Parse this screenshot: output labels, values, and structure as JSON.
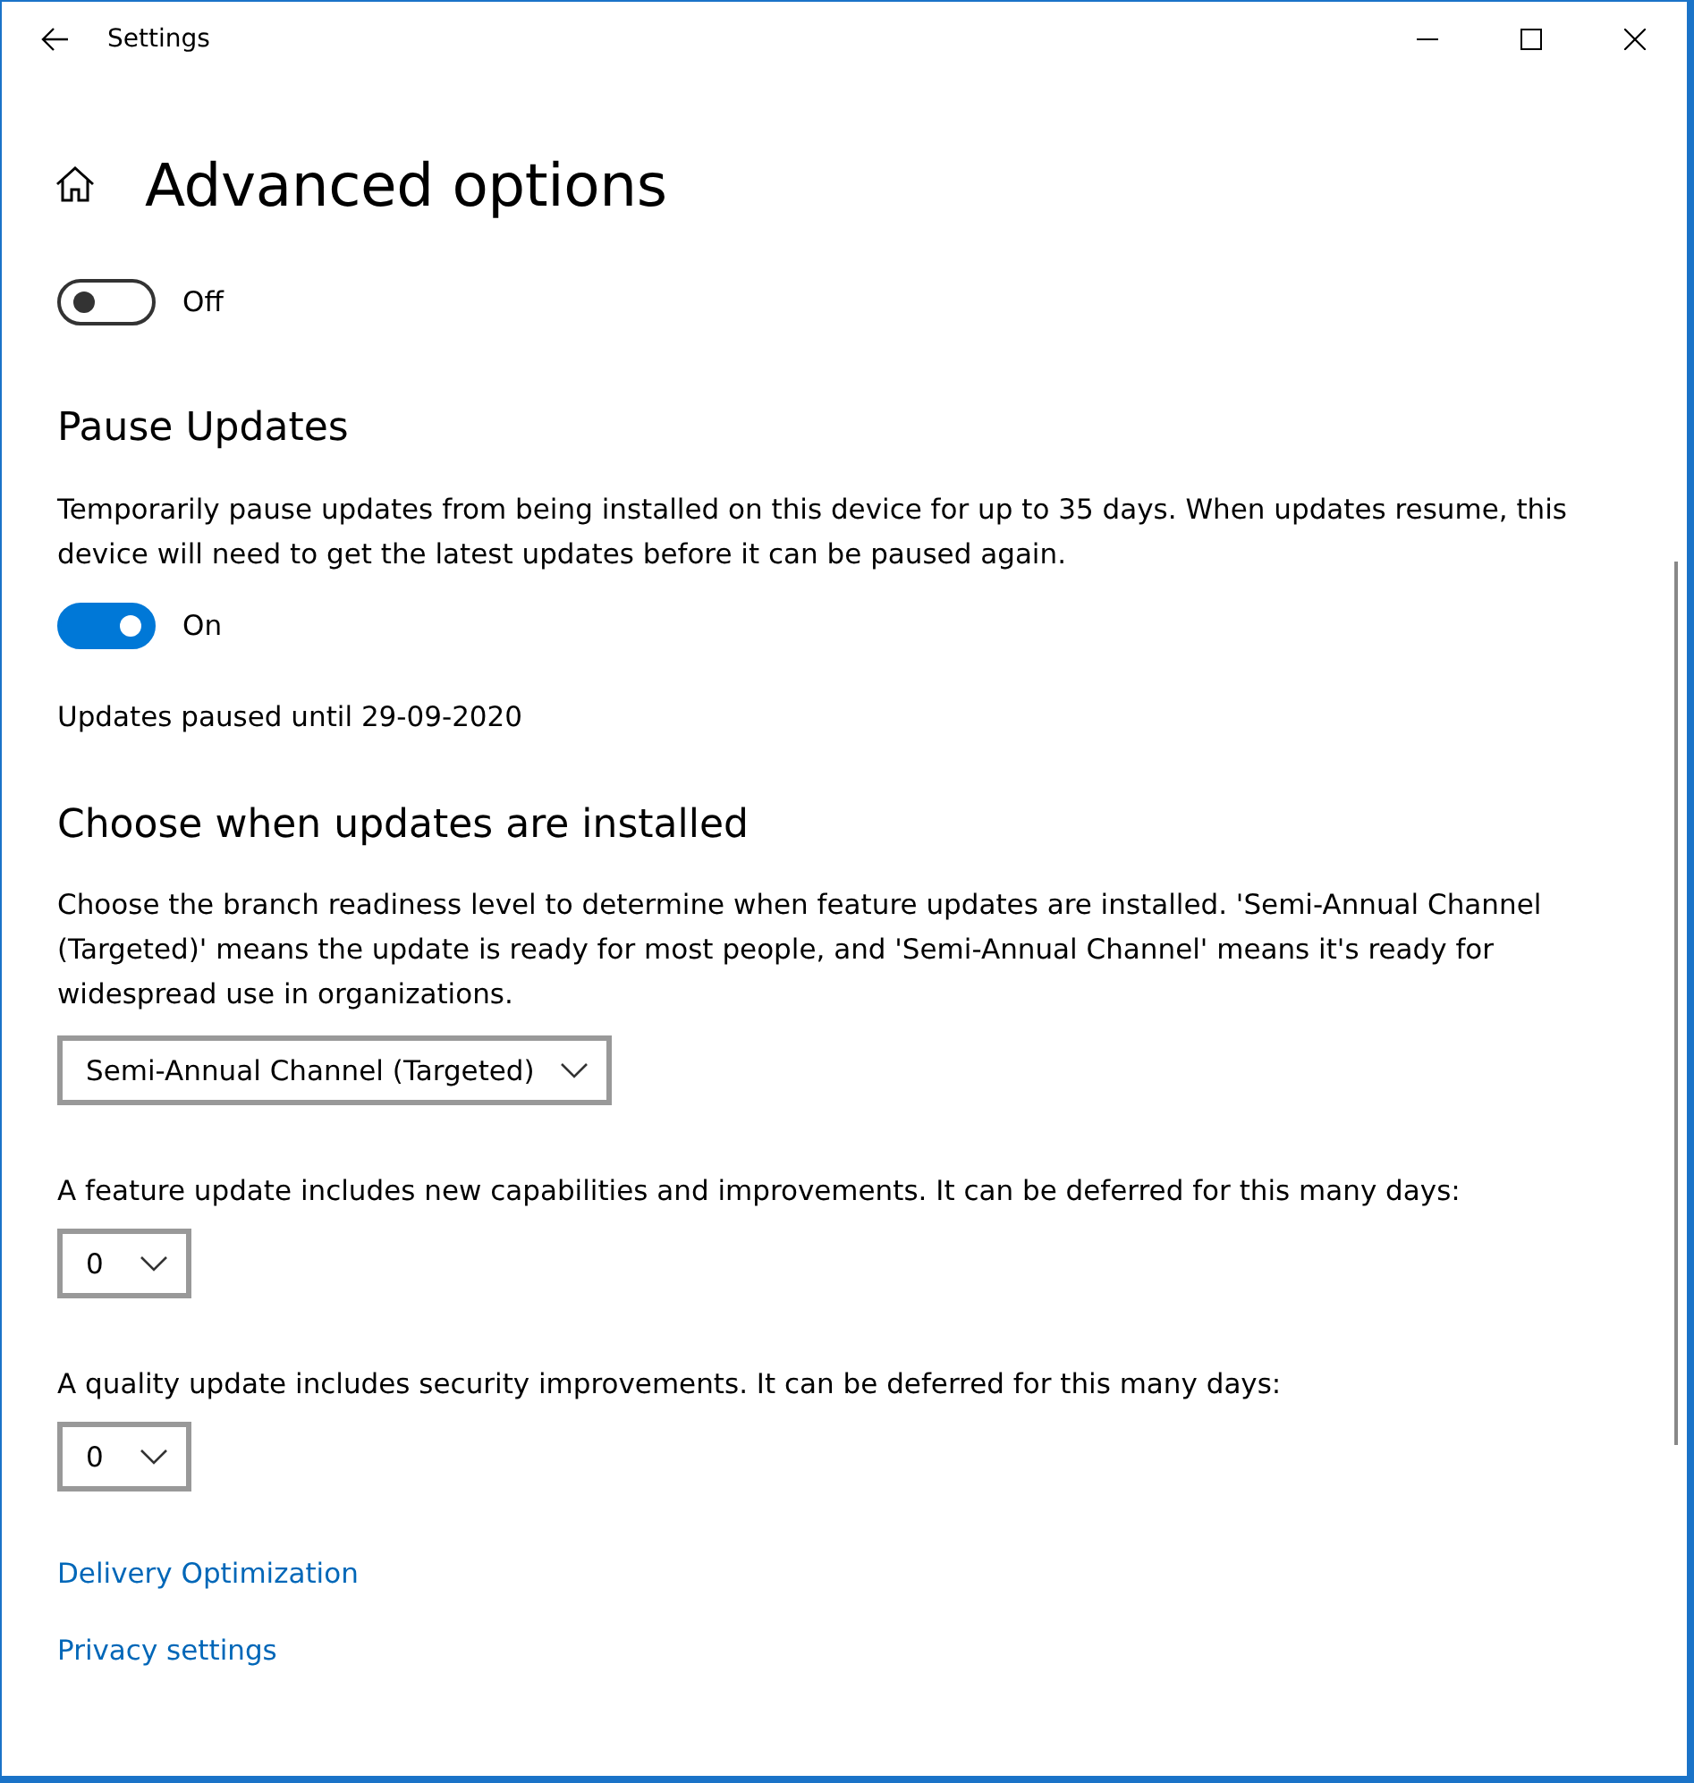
{
  "window": {
    "title": "Settings"
  },
  "page_title": "Advanced options",
  "top_toggle": {
    "on": false,
    "label": "Off"
  },
  "pause": {
    "heading": "Pause Updates",
    "description": "Temporarily pause updates from being installed on this device for up to 35 days. When updates resume, this device will need to get the latest updates before it can be paused again.",
    "toggle": {
      "on": true,
      "label": "On"
    },
    "status": "Updates paused until 29-09-2020"
  },
  "branch": {
    "heading": "Choose when updates are installed",
    "description": "Choose the branch readiness level to determine when feature updates are installed. 'Semi-Annual Channel (Targeted)' means the update is ready for most people, and 'Semi-Annual Channel' means it's ready for widespread use in organizations.",
    "dropdown": "Semi-Annual Channel (Targeted)"
  },
  "deferrals": [
    {
      "label": "A feature update includes new capabilities and improvements. It can be deferred for this many days:",
      "value": "0"
    },
    {
      "label": "A quality update includes security improvements. It can be deferred for this many days:",
      "value": "0"
    }
  ],
  "links": [
    "Delivery Optimization",
    "Privacy settings"
  ]
}
